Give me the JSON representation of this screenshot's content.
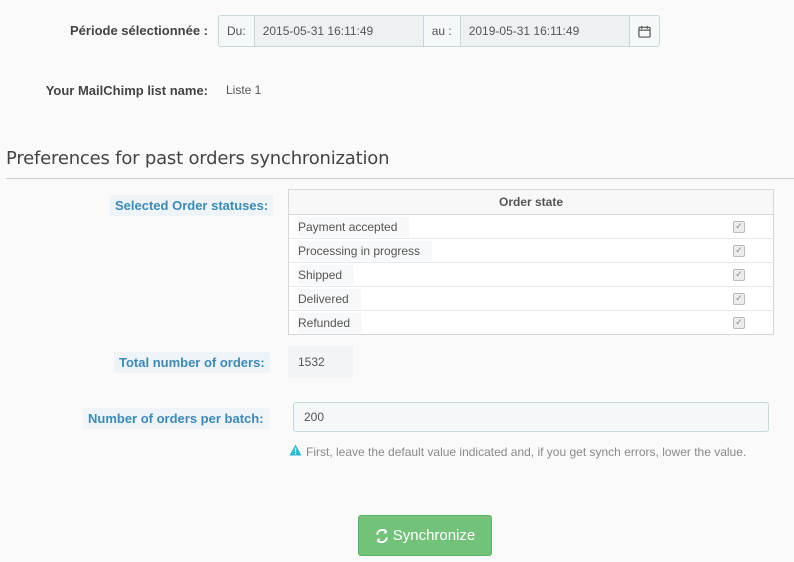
{
  "period": {
    "label": "Période sélectionnée :",
    "from_prefix": "Du:",
    "from_value": "2015-05-31 16:11:49",
    "to_prefix": "au :",
    "to_value": "2019-05-31 16:11:49",
    "calendar_icon": "calendar-icon"
  },
  "list": {
    "label": "Your MailChimp list name:",
    "value": "Liste 1"
  },
  "section": {
    "title": "Preferences for past orders synchronization"
  },
  "statuses": {
    "label": "Selected Order statuses:",
    "column_header": "Order state",
    "items": [
      {
        "name": "Payment accepted",
        "checked": true
      },
      {
        "name": "Processing in progress",
        "checked": true
      },
      {
        "name": "Shipped",
        "checked": true
      },
      {
        "name": "Delivered",
        "checked": true
      },
      {
        "name": "Refunded",
        "checked": true
      }
    ]
  },
  "total": {
    "label": "Total number of orders:",
    "value": "1532"
  },
  "batch": {
    "label": "Number of orders per batch:",
    "value": "200",
    "help": "First, leave the default value indicated and, if you get synch errors, lower the value.",
    "help_icon": "warning-icon"
  },
  "actions": {
    "sync_label": "Synchronize",
    "sync_icon": "refresh-icon",
    "accent_color": "#72c279"
  }
}
